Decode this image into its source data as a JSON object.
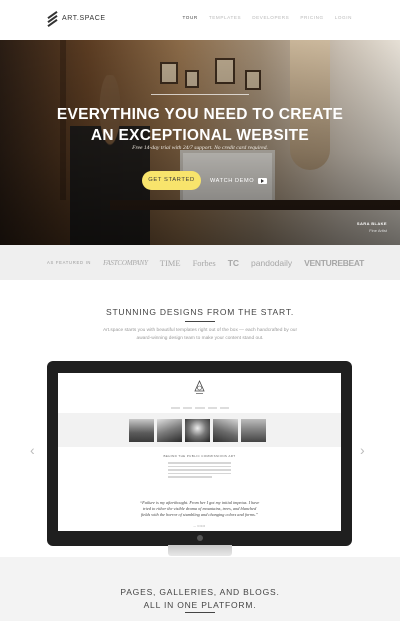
{
  "brand": {
    "name": "ART.SPACE"
  },
  "nav": {
    "items": [
      "TOUR",
      "TEMPLATES",
      "DEVELOPERS",
      "PRICING",
      "LOGIN"
    ],
    "active": 0
  },
  "hero": {
    "title_line1": "EVERYTHING YOU NEED TO CREATE",
    "title_line2": "AN EXCEPTIONAL WEBSITE",
    "subtitle": "Free 14-day trial with 24/7 support. No credit card required.",
    "cta_label": "GET STARTED",
    "watch_label": "WATCH DEMO",
    "credit_name": "SARA BLAKE",
    "credit_role": "Fine Artist"
  },
  "featured": {
    "label": "AS FEATURED IN",
    "brands": [
      "FASTCOMPANY",
      "TIME",
      "Forbes",
      "TC",
      "pandodaily",
      "VENTUREBEAT"
    ]
  },
  "section1": {
    "title": "STUNNING DESIGNS FROM THE START.",
    "text": "Art.space starts you with beautiful templates right out of the box — each handcrafted by our award-winning design team to make your content stand out."
  },
  "preview": {
    "heading": "BEHIND THE PUBLIC COMMISSIONS ART",
    "quote": "“Failure is my afterthought. From her I got my initial impetus. I have tried to rither the visible drama of mountains, trees, and blanched fields with the horror of stumbling and changing colors and forms.”",
    "author": "— NICO"
  },
  "section2": {
    "title_line1": "PAGES, GALLERIES, AND BLOGS.",
    "title_line2": "ALL IN ONE PLATFORM."
  },
  "colors": {
    "accent": "#f8e46c",
    "text": "#333333",
    "muted": "#9a9a9a",
    "band": "#efefef"
  }
}
